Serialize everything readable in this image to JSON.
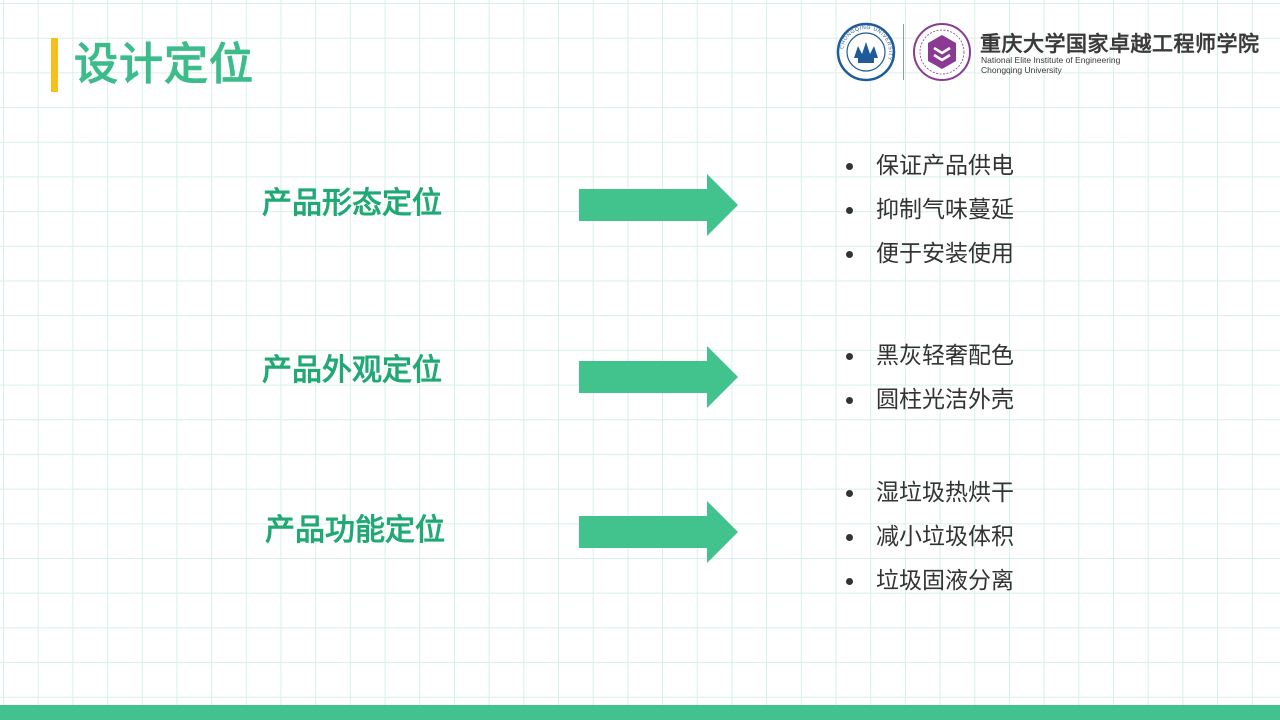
{
  "slide": {
    "title": "设计定位",
    "colors": {
      "accent": "#3dbc8b",
      "label": "#20a875",
      "arrow": "#42c38e",
      "title_marker": "#f4c01e",
      "grid": "#d9efe9"
    }
  },
  "header_logo": {
    "institution_cn": "重庆大学国家卓越工程师学院",
    "institution_en_line1": "National Elite Institute of Engineering",
    "institution_en_line2": "Chongqing University",
    "university_emblem_text": "CHONGQING UNIVERSITY",
    "university_emblem_seal": "重庆大学"
  },
  "sections": [
    {
      "label": "产品形态定位",
      "items": [
        "保证产品供电",
        "抑制气味蔓延",
        "便于安装使用"
      ]
    },
    {
      "label": "产品外观定位",
      "items": [
        "黑灰轻奢配色",
        "圆柱光洁外壳"
      ]
    },
    {
      "label": "产品功能定位",
      "items": [
        "湿垃圾热烘干",
        "减小垃圾体积",
        "垃圾固液分离"
      ]
    }
  ]
}
